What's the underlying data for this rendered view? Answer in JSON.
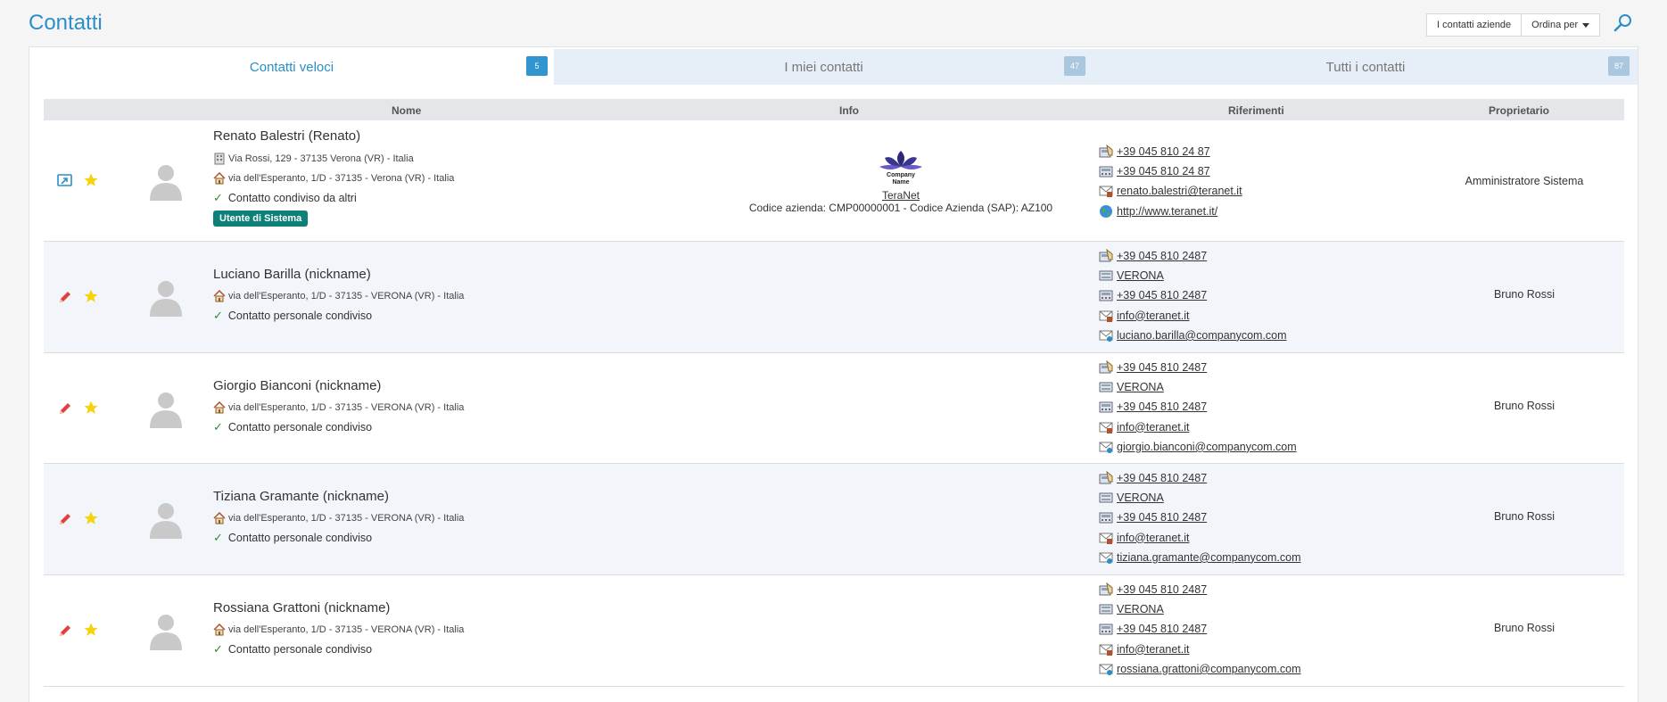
{
  "header": {
    "title": "Contatti",
    "company_contacts_label": "I contatti aziende",
    "sort_label": "Ordina per",
    "search_icon": "search-icon"
  },
  "tabs": [
    {
      "label": "Contatti veloci",
      "count": "5",
      "active": true
    },
    {
      "label": "I miei contatti",
      "count": "47",
      "active": false
    },
    {
      "label": "Tutti i contatti",
      "count": "87",
      "active": false
    }
  ],
  "table": {
    "columns": [
      "Nome",
      "Info",
      "Riferimenti",
      "Proprietario"
    ]
  },
  "contacts": [
    {
      "name": "Renato Balestri (Renato)",
      "address_work": "Via Rossi, 129 - 37135 Verona (VR) - Italia",
      "address_home": "via dell'Esperanto, 1/D - 37135 - Verona (VR) - Italia",
      "status": "Contatto condiviso da altri",
      "badge": "Utente di Sistema",
      "company_logo_text": "Company Name",
      "company_name": "TeraNet",
      "company_codes": "Codice azienda: CMP00000001 - Codice Azienda (SAP): AZ100",
      "refs": [
        "+39 045 810 24 87",
        "+39 045 810 24 87",
        "renato.balestri@teranet.it",
        "http://www.teranet.it/"
      ],
      "owner": "Amministratore Sistema"
    },
    {
      "name": "Luciano Barilla (nickname)",
      "address_home": "via dell'Esperanto, 1/D - 37135 - VERONA (VR) - Italia",
      "status": "Contatto personale condiviso",
      "refs": [
        "+39 045 810 2487",
        "VERONA",
        "+39 045 810 2487",
        "info@teranet.it",
        "luciano.barilla@companycom.com"
      ],
      "owner": "Bruno Rossi"
    },
    {
      "name": "Giorgio Bianconi (nickname)",
      "address_home": "via dell'Esperanto, 1/D - 37135 - VERONA (VR) - Italia",
      "status": "Contatto personale condiviso",
      "refs": [
        "+39 045 810 2487",
        "VERONA",
        "+39 045 810 2487",
        "info@teranet.it",
        "giorgio.bianconi@companycom.com"
      ],
      "owner": "Bruno Rossi"
    },
    {
      "name": "Tiziana Gramante (nickname)",
      "address_home": "via dell'Esperanto, 1/D - 37135 - VERONA (VR) - Italia",
      "status": "Contatto personale condiviso",
      "refs": [
        "+39 045 810 2487",
        "VERONA",
        "+39 045 810 2487",
        "info@teranet.it",
        "tiziana.gramante@companycom.com"
      ],
      "owner": "Bruno Rossi"
    },
    {
      "name": "Rossiana Grattoni (nickname)",
      "address_home": "via dell'Esperanto, 1/D - 37135 - VERONA (VR) - Italia",
      "status": "Contatto personale condiviso",
      "refs": [
        "+39 045 810 2487",
        "VERONA",
        "+39 045 810 2487",
        "info@teranet.it",
        "rossiana.grattoni@companycom.com"
      ],
      "owner": "Bruno Rossi"
    }
  ]
}
